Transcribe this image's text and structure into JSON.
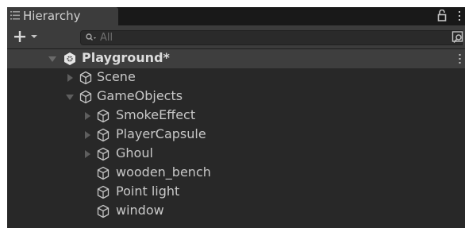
{
  "window": {
    "tab_title": "Hierarchy"
  },
  "toolbar": {
    "add_label": "+",
    "search": {
      "placeholder": "All",
      "value": ""
    }
  },
  "tree": {
    "root": {
      "label": "Playground*",
      "expanded": true
    },
    "items": [
      {
        "label": "Scene",
        "depth": 1,
        "has_children": true,
        "expanded": false
      },
      {
        "label": "GameObjects",
        "depth": 1,
        "has_children": true,
        "expanded": true
      },
      {
        "label": "SmokeEffect",
        "depth": 2,
        "has_children": true,
        "expanded": false
      },
      {
        "label": "PlayerCapsule",
        "depth": 2,
        "has_children": true,
        "expanded": false
      },
      {
        "label": "Ghoul",
        "depth": 2,
        "has_children": true,
        "expanded": false
      },
      {
        "label": "wooden_bench",
        "depth": 2,
        "has_children": false
      },
      {
        "label": "Point light",
        "depth": 2,
        "has_children": false
      },
      {
        "label": "window",
        "depth": 2,
        "has_children": false
      }
    ]
  },
  "colors": {
    "panel_background": "#282828",
    "toolbar_background": "#3c3c3c",
    "selected_row": "#3e3e3e",
    "text": "#c8c8c8"
  },
  "icons": [
    "hierarchy-icon",
    "lock-icon",
    "kebab-menu-icon",
    "add-icon",
    "dropdown-icon",
    "search-icon",
    "scene-search-icon",
    "unity-scene-icon",
    "expand-arrow-icon",
    "collapse-arrow-icon",
    "gameobject-cube-icon"
  ]
}
